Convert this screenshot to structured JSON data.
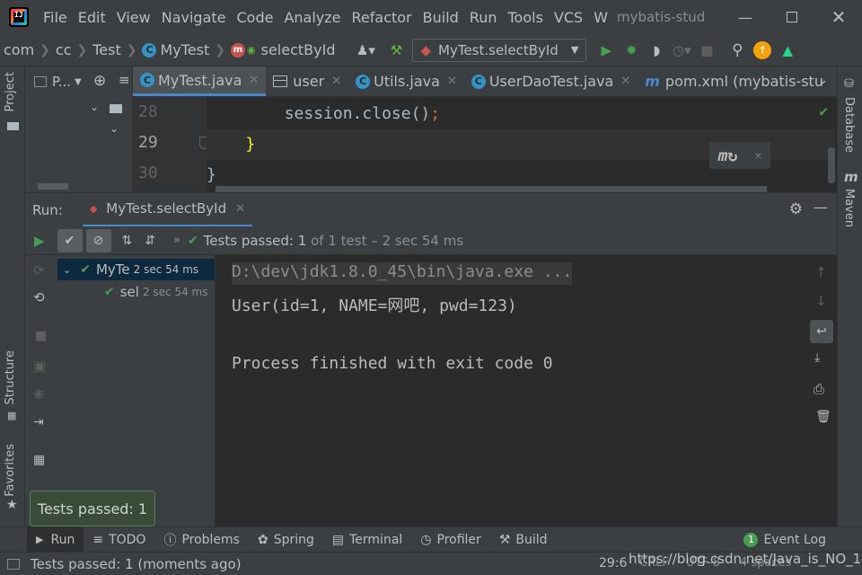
{
  "menubar": {
    "items": [
      "File",
      "Edit",
      "View",
      "Navigate",
      "Code",
      "Analyze",
      "Refactor",
      "Build",
      "Run",
      "Tools",
      "VCS",
      "W"
    ],
    "project_title": "mybatis-stud"
  },
  "navbar": {
    "crumbs": [
      "com",
      "cc",
      "Test",
      "MyTest",
      "selectById"
    ],
    "run_config": "MyTest.selectById"
  },
  "project_panel": {
    "label": "P..."
  },
  "editor": {
    "tabs": [
      {
        "label": "MyTest.java",
        "icon": "class-icon"
      },
      {
        "label": "user",
        "icon": "table-icon"
      },
      {
        "label": "Utils.java",
        "icon": "class-icon"
      },
      {
        "label": "UserDaoTest.java",
        "icon": "class-icon"
      },
      {
        "label": "pom.xml (mybatis-stu",
        "icon": "maven-icon"
      }
    ],
    "lines": [
      {
        "num": "28",
        "code": "        session.close();"
      },
      {
        "num": "29",
        "code": "    }"
      },
      {
        "num": "30",
        "code": "}"
      }
    ]
  },
  "run": {
    "label": "Run:",
    "tab": "MyTest.selectById",
    "status_prefix": "Tests passed:",
    "status_count": "1",
    "status_suffix": "of 1 test – 2 sec 54 ms",
    "tree": [
      {
        "name": "MyTe",
        "time": "2 sec 54 ms"
      },
      {
        "name": "sel",
        "time": "2 sec 54 ms"
      }
    ],
    "console": [
      "D:\\dev\\jdk1.8.0_45\\bin\\java.exe ...",
      "User(id=1, NAME=网吧, pwd=123)",
      "",
      "Process finished with exit code 0"
    ]
  },
  "left_strip": {
    "project": "Project",
    "structure": "Structure",
    "favorites": "Favorites"
  },
  "right_strip": {
    "database": "Database",
    "maven": "Maven"
  },
  "tooltip": "Tests passed: 1",
  "bottom_tools": [
    "Run",
    "TODO",
    "Problems",
    "Spring",
    "Terminal",
    "Profiler",
    "Build"
  ],
  "event_log": {
    "badge": "1",
    "label": "Event Log"
  },
  "status": {
    "message": "Tests passed: 1 (moments ago)",
    "position": "29:6",
    "line_sep": "CRLF",
    "encoding": "UTF-8",
    "indent": "4 spaces",
    "watermark": "https://blog.csdn.net/Java_is_NO_1"
  },
  "colors": {
    "accent": "#4a88c7",
    "pass": "#499c54",
    "keyword": "#cc7832"
  }
}
